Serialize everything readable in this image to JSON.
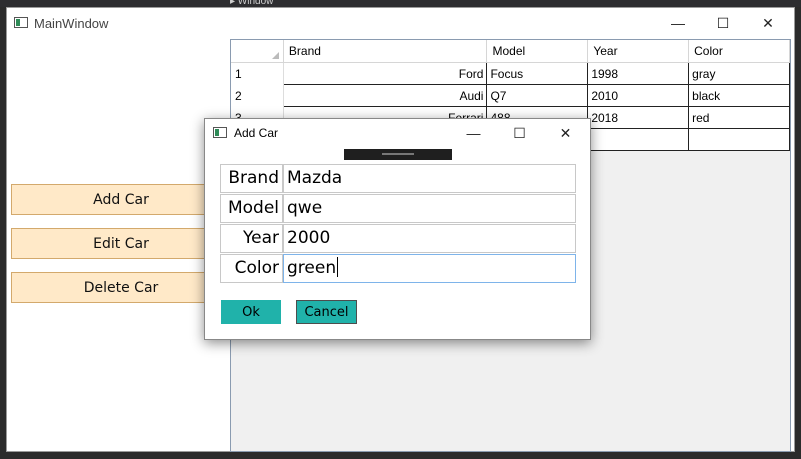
{
  "ide": {
    "tab_label": "▸ Window"
  },
  "main_window": {
    "title": "MainWindow",
    "buttons": {
      "add": "Add Car",
      "edit": "Edit Car",
      "delete": "Delete Car"
    },
    "caption": {
      "minimize": "—",
      "maximize": "☐",
      "close": "✕"
    }
  },
  "grid": {
    "columns": [
      "Brand",
      "Model",
      "Year",
      "Color"
    ],
    "rows": [
      {
        "num": "1",
        "brand": "Ford",
        "model": "Focus",
        "year": "1998",
        "color": "gray"
      },
      {
        "num": "2",
        "brand": "Audi",
        "model": "Q7",
        "year": "2010",
        "color": "black"
      },
      {
        "num": "3",
        "brand": "Ferrari",
        "model": "488",
        "year": "2018",
        "color": "red"
      },
      {
        "num": "",
        "brand": "",
        "model": "",
        "year": "",
        "color": ""
      }
    ]
  },
  "dialog": {
    "title": "Add Car",
    "caption": {
      "minimize": "—",
      "maximize": "☐",
      "close": "✕"
    },
    "fields": [
      {
        "label": "Brand",
        "value": "Mazda"
      },
      {
        "label": "Model",
        "value": "qwe"
      },
      {
        "label": "Year",
        "value": "2000"
      },
      {
        "label": "Color",
        "value": "green"
      }
    ],
    "ok_label": "Ok",
    "cancel_label": "Cancel"
  },
  "colors": {
    "button_bg": "#ffe9c8",
    "dialog_button_bg": "#20b2aa",
    "focus_border": "#7eb4ea"
  }
}
